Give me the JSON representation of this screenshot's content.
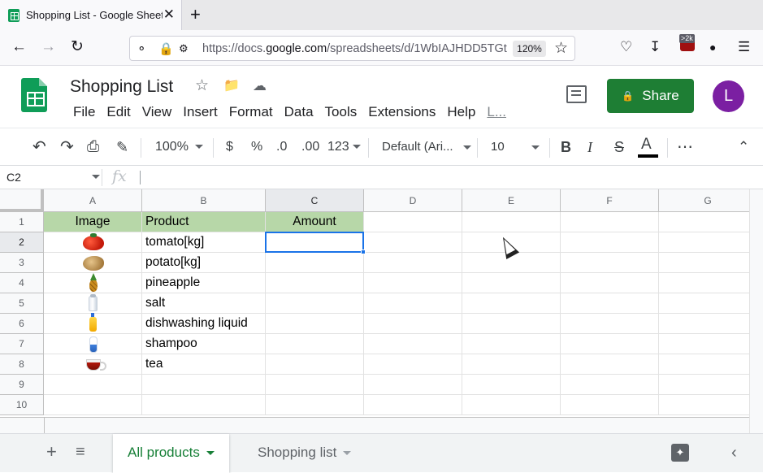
{
  "browser": {
    "tab_title": "Shopping List - Google Sheets",
    "tab_close": "✕",
    "new_tab": "+",
    "url_prefix": "https://docs.",
    "url_host": "google.com",
    "url_rest": "/spreadsheets/d/1WbIAJHDD5TGt",
    "zoom": "120%",
    "extension_count": ">2k"
  },
  "app": {
    "title": "Shopping List",
    "menu": [
      "File",
      "Edit",
      "View",
      "Insert",
      "Format",
      "Data",
      "Tools",
      "Extensions",
      "Help",
      "L..."
    ],
    "share_label": "Share",
    "avatar_letter": "L"
  },
  "toolbar": {
    "zoom": "100%",
    "currency": "$",
    "percent": "%",
    "decrease_decimal": ".0",
    "increase_decimal": ".00",
    "number_format": "123",
    "font": "Default (Ari...",
    "font_size": "10",
    "bold": "B",
    "italic": "I",
    "strike": "S",
    "text_color": "A",
    "more": "⋯"
  },
  "formula_bar": {
    "name_box": "C2",
    "fx": "fx",
    "content": ""
  },
  "grid": {
    "columns": [
      "A",
      "B",
      "C",
      "D",
      "E",
      "F",
      "G"
    ],
    "rows": [
      "1",
      "2",
      "3",
      "4",
      "5",
      "6",
      "7",
      "8",
      "9",
      "10"
    ],
    "header": {
      "image": "Image",
      "product": "Product",
      "amount": "Amount"
    },
    "products": [
      {
        "image": "tomato-icon",
        "name": "tomato[kg]",
        "amount": ""
      },
      {
        "image": "potato-icon",
        "name": "potato[kg]",
        "amount": ""
      },
      {
        "image": "pineapple-icon",
        "name": "pineapple",
        "amount": ""
      },
      {
        "image": "salt-icon",
        "name": "salt",
        "amount": ""
      },
      {
        "image": "dishwashing-liquid-icon",
        "name": "dishwashing liquid",
        "amount": ""
      },
      {
        "image": "shampoo-icon",
        "name": "shampoo",
        "amount": ""
      },
      {
        "image": "tea-icon",
        "name": "tea",
        "amount": ""
      }
    ],
    "selected_cell": "C2",
    "header_fill": "#b7d7a8",
    "selection_color": "#1a73e8"
  },
  "sheets": {
    "tabs": [
      "All products",
      "Shopping list"
    ],
    "active_tab": "All products",
    "add_label": "+",
    "list_label": "≡"
  },
  "colors": {
    "share_button": "#1e7e34",
    "avatar": "#7b1fa2",
    "active_tab_text": "#188038"
  }
}
